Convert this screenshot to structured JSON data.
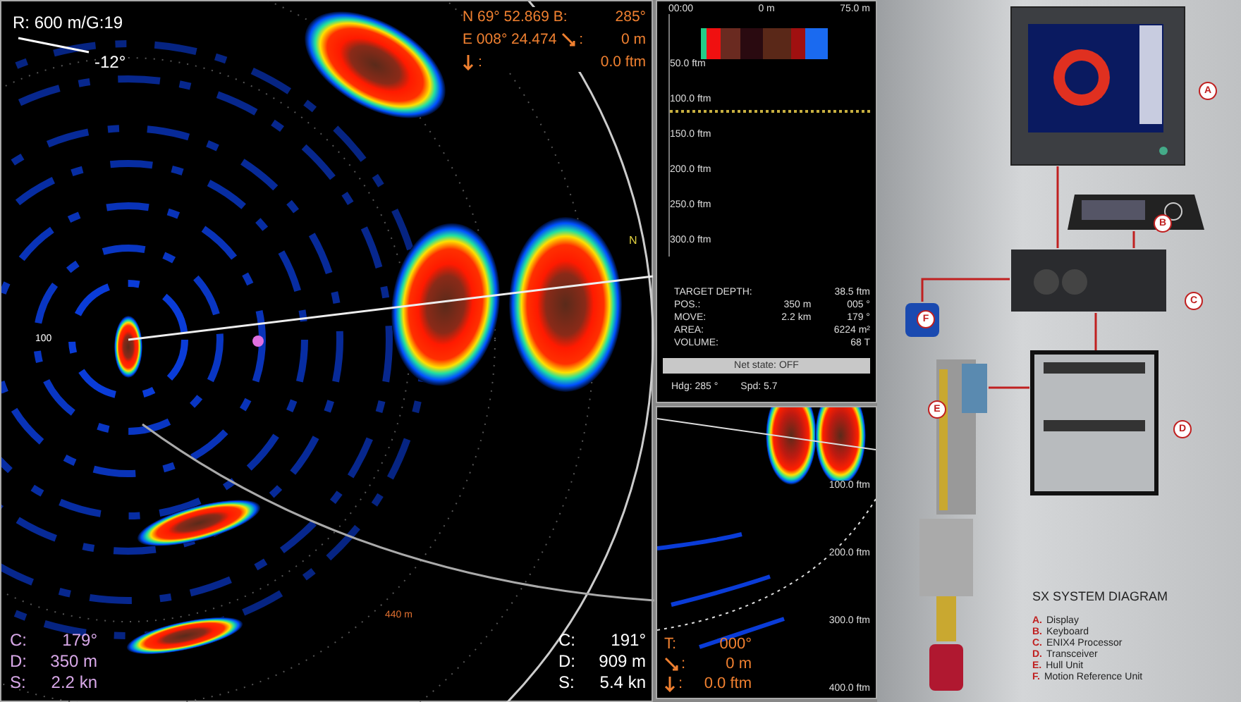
{
  "sonar": {
    "range_gain": "R: 600 m/G:19",
    "tilt": "-12°",
    "position": [
      {
        "kind": "text",
        "label": "N  69° 52.869",
        "key": "B:",
        "value": "285°"
      },
      {
        "kind": "slant",
        "label": "E 008° 24.474",
        "key": ":",
        "value": "0 m"
      },
      {
        "kind": "depth",
        "key": ":",
        "value": "0.0 ftm"
      }
    ],
    "range_label": "100",
    "north_label": "N",
    "ring_label": "440 m",
    "target_left": [
      {
        "key": "C:",
        "value": "179°"
      },
      {
        "key": "D:",
        "value": "350 m"
      },
      {
        "key": "S:",
        "value": "2.2 kn"
      }
    ],
    "target_right": [
      {
        "key": "C:",
        "value": "191°"
      },
      {
        "key": "D:",
        "value": "909 m"
      },
      {
        "key": "S:",
        "value": "5.4 kn"
      }
    ]
  },
  "echogram": {
    "time": "00:00",
    "scale_start": "0 m",
    "scale_end": "75.0 m",
    "depths": [
      "50.0 ftm",
      "100.0 ftm",
      "150.0 ftm",
      "200.0 ftm",
      "250.0 ftm",
      "300.0 ftm"
    ],
    "info": [
      {
        "label": "TARGET DEPTH:",
        "value_2": "38.5 ftm"
      },
      {
        "label": "POS.:",
        "value_1": "350 m",
        "value_2": "005 °"
      },
      {
        "label": "MOVE:",
        "value_1": "2.2 km",
        "value_2": "179 °"
      },
      {
        "label": "AREA:",
        "value_2": "6224 m²"
      },
      {
        "label": "VOLUME:",
        "value_2": "68 T"
      }
    ],
    "net_state": "Net state: OFF",
    "heading": "Hdg:  285 °",
    "speed": "Spd:   5.7"
  },
  "side_view": {
    "depths": [
      "100.0 ftm",
      "200.0 ftm",
      "300.0 ftm",
      "400.0 ftm"
    ],
    "readings": [
      {
        "kind": "tilt",
        "key": "T:",
        "value": "000°"
      },
      {
        "kind": "slant",
        "key": ":",
        "value": "0 m"
      },
      {
        "kind": "depth",
        "key": ":",
        "value": "0.0 ftm"
      }
    ]
  },
  "diagram": {
    "callouts": [
      "A",
      "B",
      "C",
      "F",
      "D",
      "E"
    ],
    "title": "SX SYSTEM DIAGRAM",
    "legend": [
      {
        "letter": "A.",
        "label": "Display"
      },
      {
        "letter": "B.",
        "label": "Keyboard"
      },
      {
        "letter": "C.",
        "label": "ENIX4 Processor"
      },
      {
        "letter": "D.",
        "label": "Transceiver"
      },
      {
        "letter": "E.",
        "label": "Hull Unit"
      },
      {
        "letter": "F.",
        "label": "Motion Reference Unit"
      }
    ]
  }
}
